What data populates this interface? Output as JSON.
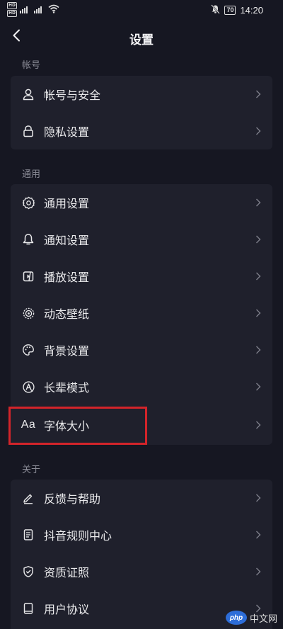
{
  "status_bar": {
    "hd1": "HD",
    "hd2": "HD",
    "signal": "4G",
    "battery": "70",
    "time": "14:20"
  },
  "nav": {
    "title": "设置"
  },
  "sections": {
    "account": {
      "label": "帐号",
      "items": [
        {
          "label": "帐号与安全",
          "icon": "person-icon"
        },
        {
          "label": "隐私设置",
          "icon": "lock-icon"
        }
      ]
    },
    "general": {
      "label": "通用",
      "items": [
        {
          "label": "通用设置",
          "icon": "gear-icon"
        },
        {
          "label": "通知设置",
          "icon": "bell-icon"
        },
        {
          "label": "播放设置",
          "icon": "play-settings-icon"
        },
        {
          "label": "动态壁纸",
          "icon": "wallpaper-icon"
        },
        {
          "label": "背景设置",
          "icon": "palette-icon"
        },
        {
          "label": "长辈模式",
          "icon": "elder-mode-icon"
        },
        {
          "label": "字体大小",
          "icon": "font-size-icon",
          "icon_text": "Aa"
        }
      ]
    },
    "about": {
      "label": "关于",
      "items": [
        {
          "label": "反馈与帮助",
          "icon": "pen-icon"
        },
        {
          "label": "抖音规则中心",
          "icon": "rules-doc-icon"
        },
        {
          "label": "资质证照",
          "icon": "shield-check-icon"
        },
        {
          "label": "用户协议",
          "icon": "book-icon"
        }
      ]
    }
  },
  "annotation": {
    "highlighted_item": "字体大小",
    "color": "#d3242a"
  },
  "watermark": {
    "logo": "php",
    "text": "中文网"
  },
  "colors": {
    "background": "#161722",
    "card": "#1f202c",
    "text": "#eaeaec",
    "muted": "#8a8b96"
  }
}
